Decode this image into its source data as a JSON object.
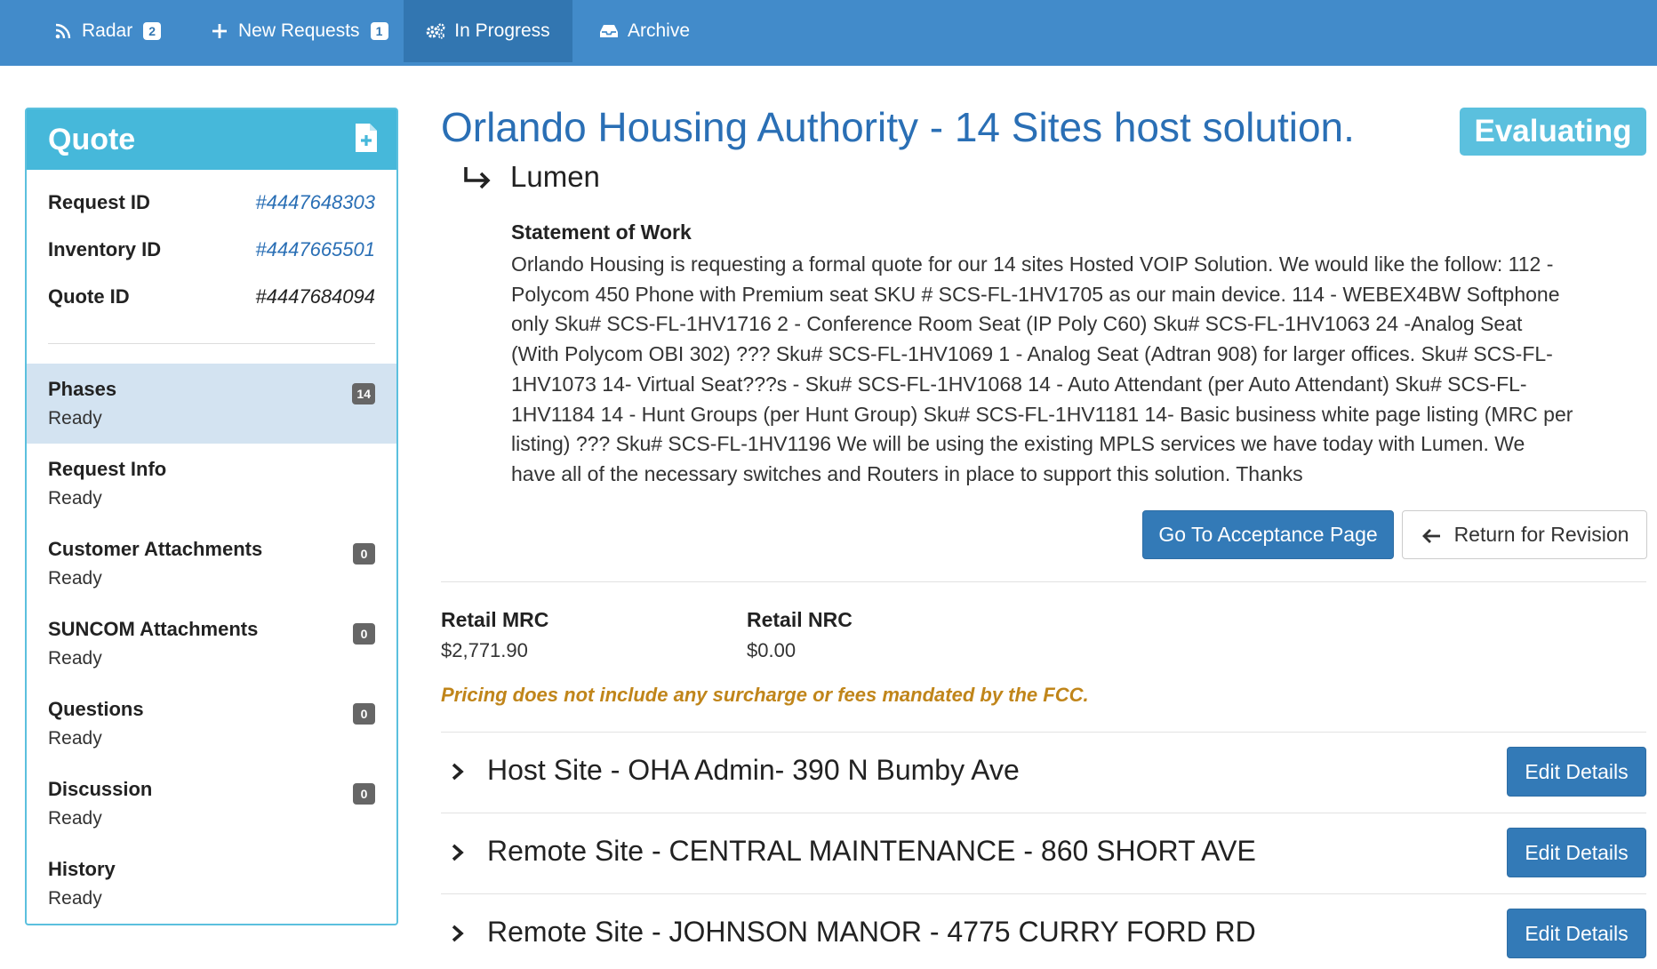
{
  "nav": {
    "radar": {
      "label": "Radar",
      "badge": "2"
    },
    "new_requests": {
      "label": "New Requests",
      "badge": "1"
    },
    "in_progress": {
      "label": "In Progress"
    },
    "archive": {
      "label": "Archive"
    }
  },
  "quote_panel": {
    "title": "Quote",
    "ids": [
      {
        "label": "Request ID",
        "value": "#4447648303"
      },
      {
        "label": "Inventory ID",
        "value": "#4447665501"
      },
      {
        "label": "Quote ID",
        "value": "#4447684094"
      }
    ],
    "phases": [
      {
        "name": "Phases",
        "status": "Ready",
        "count": "14"
      },
      {
        "name": "Request Info",
        "status": "Ready"
      },
      {
        "name": "Customer Attachments",
        "status": "Ready",
        "count": "0"
      },
      {
        "name": "SUNCOM Attachments",
        "status": "Ready",
        "count": "0"
      },
      {
        "name": "Questions",
        "status": "Ready",
        "count": "0"
      },
      {
        "name": "Discussion",
        "status": "Ready",
        "count": "0"
      },
      {
        "name": "History",
        "status": "Ready"
      }
    ]
  },
  "main": {
    "title": "Orlando Housing Authority - 14 Sites host solution.",
    "status": "Evaluating",
    "vendor": "Lumen",
    "sow_title": "Statement of Work",
    "sow_body": "Orlando Housing is requesting a formal quote for our 14 sites Hosted VOIP Solution. We would like the follow: 112 - Polycom 450 Phone with Premium seat SKU # SCS-FL-1HV1705 as our main device. 114 - WEBEX4BW Softphone only Sku# SCS-FL-1HV1716 2 - Conference Room Seat (IP Poly C60) Sku# SCS-FL-1HV1063 24 -Analog Seat (With Polycom OBI 302) ??? Sku# SCS-FL-1HV1069 1 - Analog Seat (Adtran 908) for larger offices. Sku# SCS-FL-1HV1073 14- Virtual Seat???s - Sku# SCS-FL-1HV1068 14 - Auto Attendant (per Auto Attendant) Sku# SCS-FL-1HV1184 14 - Hunt Groups (per Hunt Group) Sku# SCS-FL-1HV1181 14- Basic business white page listing (MRC per listing) ??? Sku# SCS-FL-1HV1196 We will be using the existing MPLS services we have today with Lumen. We have all of the necessary switches and Routers in place to support this solution. Thanks",
    "accept_button": "Go To Acceptance Page",
    "revise_button": "Return for Revision",
    "retail_mrc_label": "Retail MRC",
    "retail_mrc_value": "$2,771.90",
    "retail_nrc_label": "Retail NRC",
    "retail_nrc_value": "$0.00",
    "fcc_note": "Pricing does not include any surcharge or fees mandated by the FCC.",
    "sites": [
      {
        "title": "Host Site - OHA Admin- 390 N Bumby Ave",
        "button": "Edit Details"
      },
      {
        "title": "Remote Site - CENTRAL MAINTENANCE - 860 SHORT AVE",
        "button": "Edit Details"
      },
      {
        "title": "Remote Site - JOHNSON MANOR - 4775 CURRY FORD RD",
        "button": "Edit Details"
      }
    ]
  },
  "colors": {
    "navbar": "#428bca",
    "navbar_active": "#3276b1",
    "panel_header": "#46b8da",
    "title_blue": "#2a6fb5",
    "status_badge": "#5bc0de",
    "primary_button": "#337ab7",
    "active_phase": "#d3e3f1",
    "fcc_note": "#c0851a"
  },
  "icons": {
    "radar": "rss-icon",
    "new_requests": "plus-icon",
    "in_progress": "gears-icon",
    "archive": "inbox-icon",
    "quote": "file-plus-icon",
    "vendor": "arrow-turn-right-icon",
    "revise": "arrow-left-icon",
    "site_toggle": "chevron-right-icon"
  }
}
